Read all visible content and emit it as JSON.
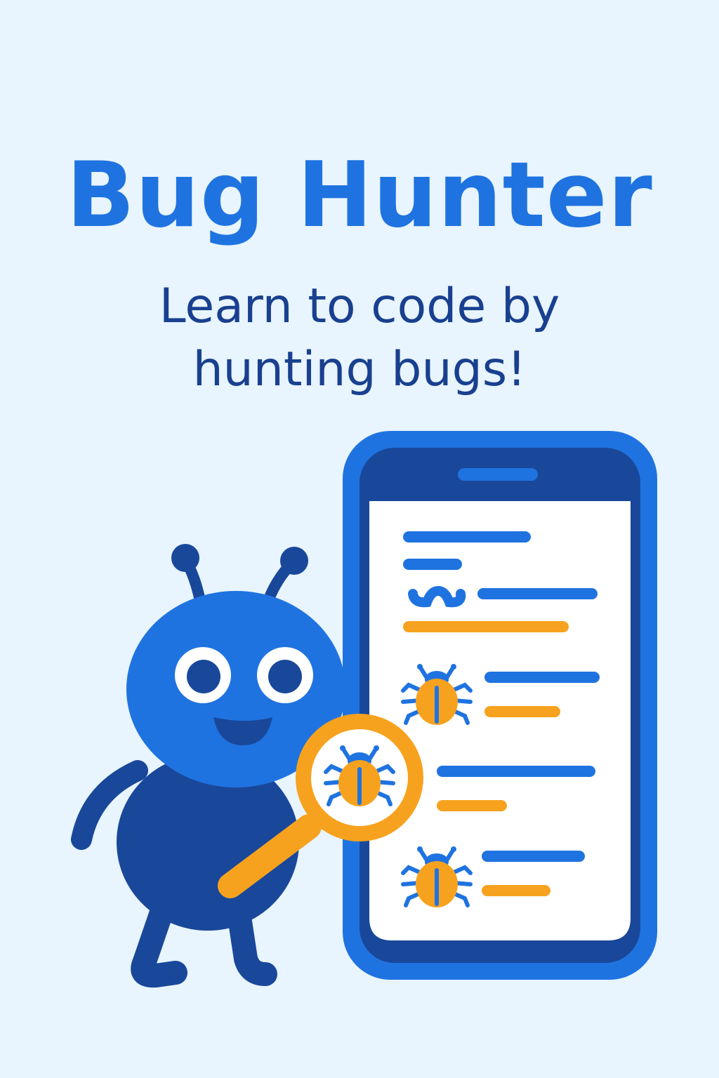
{
  "header": {
    "title": "Bug Hunter",
    "subtitle_line1": "Learn to code by",
    "subtitle_line2": "hunting bugs!"
  },
  "colors": {
    "background": "#e8f4fe",
    "primary_blue": "#1f73e0",
    "dark_blue": "#19489a",
    "orange": "#f7a21e",
    "white": "#ffffff"
  },
  "illustration": {
    "mascot": "blue-bug-mascot",
    "tool": "magnifying-glass-icon",
    "device": "smartphone-with-code-lines"
  }
}
